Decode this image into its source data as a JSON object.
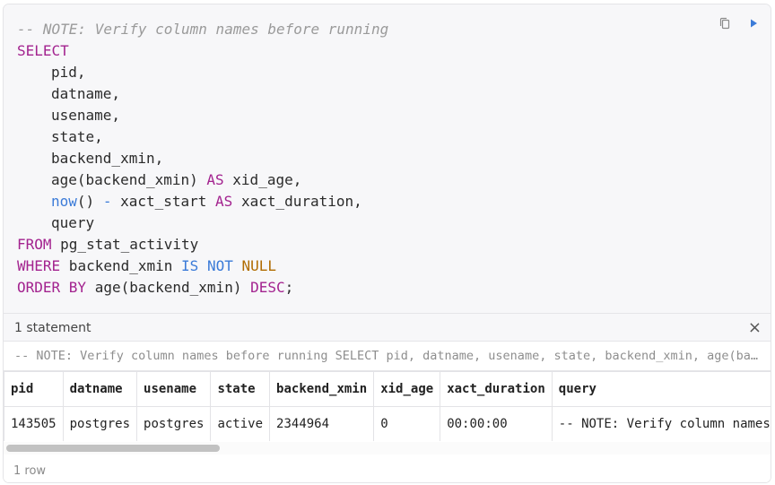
{
  "editor": {
    "lines": [
      [
        {
          "t": "-- NOTE: Verify column names before running",
          "c": "comment"
        }
      ],
      [
        {
          "t": "SELECT",
          "c": "keyword"
        }
      ],
      [
        {
          "t": "",
          "c": "indent"
        },
        {
          "t": "pid,",
          "c": "ident"
        }
      ],
      [
        {
          "t": "",
          "c": "indent"
        },
        {
          "t": "datname,",
          "c": "ident"
        }
      ],
      [
        {
          "t": "",
          "c": "indent"
        },
        {
          "t": "usename,",
          "c": "ident"
        }
      ],
      [
        {
          "t": "",
          "c": "indent"
        },
        {
          "t": "state,",
          "c": "ident"
        }
      ],
      [
        {
          "t": "",
          "c": "indent"
        },
        {
          "t": "backend_xmin,",
          "c": "ident"
        }
      ],
      [
        {
          "t": "",
          "c": "indent"
        },
        {
          "t": "age(backend_xmin) ",
          "c": "ident"
        },
        {
          "t": "AS",
          "c": "keyword"
        },
        {
          "t": " xid_age,",
          "c": "ident"
        }
      ],
      [
        {
          "t": "",
          "c": "indent"
        },
        {
          "t": "now",
          "c": "func"
        },
        {
          "t": "() ",
          "c": "ident"
        },
        {
          "t": "-",
          "c": "op"
        },
        {
          "t": " xact_start ",
          "c": "ident"
        },
        {
          "t": "AS",
          "c": "keyword"
        },
        {
          "t": " xact_duration,",
          "c": "ident"
        }
      ],
      [
        {
          "t": "",
          "c": "indent"
        },
        {
          "t": "query",
          "c": "ident"
        }
      ],
      [
        {
          "t": "FROM",
          "c": "keyword"
        },
        {
          "t": " pg_stat_activity",
          "c": "ident"
        }
      ],
      [
        {
          "t": "WHERE",
          "c": "keyword"
        },
        {
          "t": " backend_xmin ",
          "c": "ident"
        },
        {
          "t": "IS",
          "c": "func"
        },
        {
          "t": " ",
          "c": "ident"
        },
        {
          "t": "NOT",
          "c": "func"
        },
        {
          "t": " ",
          "c": "ident"
        },
        {
          "t": "NULL",
          "c": "null"
        }
      ],
      [
        {
          "t": "ORDER BY",
          "c": "keyword"
        },
        {
          "t": " age(backend_xmin) ",
          "c": "ident"
        },
        {
          "t": "DESC",
          "c": "keyword"
        },
        {
          "t": ";",
          "c": "ident"
        }
      ]
    ],
    "actions": {
      "copy_icon": "copy-icon",
      "run_icon": "play-icon"
    }
  },
  "results": {
    "statement_count": "1 statement",
    "close_symbol": "×",
    "statement_preview": "-- NOTE: Verify column names before running SELECT pid, datname, usename, state, backend_xmin, age(backend_xmin) AS xid_age, now() - xact_start AS xact_duration, query FROM pg_stat_activity WHERE backend_xmin IS NOT NULL ORDER BY age(backend_xmin) DESC;",
    "columns": [
      "pid",
      "datname",
      "usename",
      "state",
      "backend_xmin",
      "xid_age",
      "xact_duration",
      "query"
    ],
    "rows": [
      [
        "143505",
        "postgres",
        "postgres",
        "active",
        "2344964",
        "0",
        "00:00:00",
        "-- NOTE: Verify column names before running SELECT pid, datname, usename, state, backend_xmin, age(backend_xmin) AS xid_age, now() - xact_start AS xact_duration, query FROM pg_stat_activity WHERE backend_xmin IS NOT NULL ORDER BY age(backend_xmin) DESC;"
      ]
    ],
    "row_count": "1 row"
  },
  "colors": {
    "keyword": "#a3238f",
    "function": "#3b7bd8",
    "null": "#b06b00",
    "comment": "#9a9a9a"
  }
}
